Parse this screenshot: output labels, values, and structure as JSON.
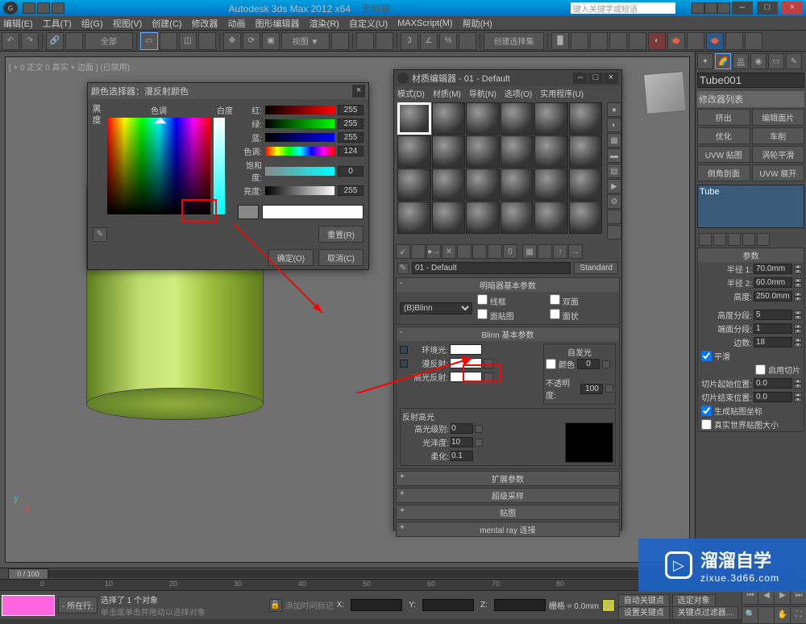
{
  "titlebar": {
    "app": "Autodesk 3ds Max  2012 x64",
    "doc": "无标题",
    "search_placeholder": "键入关键字或短语"
  },
  "menubar": [
    "编辑(E)",
    "工具(T)",
    "组(G)",
    "视图(V)",
    "创建(C)",
    "修改器",
    "动画",
    "图形编辑器",
    "渲染(R)",
    "自定义(U)",
    "MAXScript(M)",
    "帮助(H)"
  ],
  "toolbar": {
    "selset_label": "全部",
    "createset_label": "创建选择集"
  },
  "viewport": {
    "label": "[ + 0 正交 0 真实 + 边面 ] (已禁用)"
  },
  "colorpicker": {
    "title": "颜色选择器：漫反射颜色",
    "hue_label": "色调",
    "white_label": "白度",
    "black_label": "黑\n度",
    "r_label": "红:",
    "r_val": "255",
    "g_label": "绿:",
    "g_val": "255",
    "b_label": "蓝:",
    "b_val": "255",
    "h_label": "色调:",
    "h_val": "124",
    "s_label": "饱和度:",
    "s_val": "0",
    "v_label": "亮度:",
    "v_val": "255",
    "reset": "重置(R)",
    "ok": "确定(O)",
    "cancel": "取消(C)"
  },
  "material": {
    "title": "材质编辑器 - 01 - Default",
    "menu": [
      "模式(D)",
      "材质(M)",
      "导航(N)",
      "选项(O)",
      "实用程序(U)"
    ],
    "name": "01 - Default",
    "type_btn": "Standard",
    "roll_shader": "明暗器基本参数",
    "shader": "(B)Blinn",
    "chk_wire": "线框",
    "chk_2side": "双面",
    "chk_facemap": "面贴图",
    "chk_faceted": "面状",
    "roll_blinn": "Blinn 基本参数",
    "amb": "环境光:",
    "dif": "漫反射:",
    "spec": "高光反射:",
    "self_title": "自发光",
    "self_color": "颜色",
    "self_val": "0",
    "opacity": "不透明度:",
    "opacity_val": "100",
    "spec_title": "反射高光",
    "spec_level": "高光级别:",
    "spec_level_val": "0",
    "gloss": "光泽度:",
    "gloss_val": "10",
    "soften": "柔化:",
    "soften_val": "0.1",
    "roll_ext": "扩展参数",
    "roll_ss": "超级采样",
    "roll_maps": "贴图",
    "roll_mr": "mental ray 连接"
  },
  "cmdpanel": {
    "name": "Tube001",
    "modlist_label": "修改器列表",
    "btns": [
      "挤出",
      "编辑面片",
      "优化",
      "车削",
      "UVW 贴图",
      "涡轮平滑",
      "倒角剖面",
      "UVW 展开"
    ],
    "stack_item": "Tube",
    "roll_params": "参数",
    "r1": "半径 1:",
    "r1_val": "70.0mm",
    "r2": "半径 2:",
    "r2_val": "60.0mm",
    "height": "高度:",
    "height_val": "250.0mm",
    "hseg": "高度分段:",
    "hseg_val": "5",
    "cseg": "端面分段:",
    "cseg_val": "1",
    "sides": "边数:",
    "sides_val": "18",
    "smooth": "平滑",
    "slice_on": "启用切片",
    "slice_from": "切片起始位置:",
    "slice_from_val": "0.0",
    "slice_to": "切片结束位置:",
    "slice_to_val": "0.0",
    "gen_map": "生成贴图坐标",
    "real_world": "真实世界贴图大小"
  },
  "timeline": {
    "pos": "0 / 100"
  },
  "statusbar": {
    "sel_count": "选择了 1 个对象",
    "hint": "单击或单击并拖动以选择对象",
    "addtime": "添加时间标记",
    "x": "X:",
    "y": "Y:",
    "z": "Z:",
    "grid": "栅格 = 0.0mm",
    "autokey": "自动关键点",
    "selkey": "选定对象",
    "setkey": "设置关键点",
    "keyfilter": "关键点过滤器..."
  },
  "watermark": {
    "brand": "溜溜自学",
    "url": "zixue.3d66.com"
  }
}
